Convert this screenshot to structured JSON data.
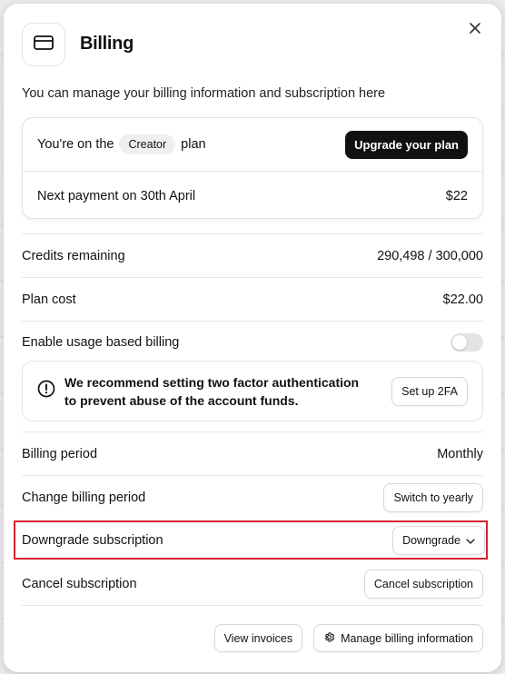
{
  "dialog": {
    "title": "Billing",
    "subtitle": "You can manage your billing information and subscription here",
    "header_icon": "credit-card-icon",
    "close_icon": "close-icon"
  },
  "plan": {
    "prefix": "You're on the",
    "name": "Creator",
    "suffix": "plan",
    "upgrade_label": "Upgrade your plan",
    "next_payment_label": "Next payment on 30th April",
    "next_payment_amount": "$22"
  },
  "credits": {
    "label": "Credits remaining",
    "value": "290,498 / 300,000"
  },
  "plan_cost": {
    "label": "Plan cost",
    "value": "$22.00"
  },
  "usage_billing": {
    "label": "Enable usage based billing",
    "enabled": false
  },
  "alert": {
    "icon": "alert-circle-icon",
    "line1": "We recommend setting two factor authentication",
    "line2": "to prevent abuse of the account funds.",
    "button_label": "Set up 2FA"
  },
  "billing_period": {
    "label": "Billing period",
    "value": "Monthly"
  },
  "change_period": {
    "label": "Change billing period",
    "button_label": "Switch to yearly"
  },
  "downgrade": {
    "label": "Downgrade subscription",
    "button_label": "Downgrade"
  },
  "cancel": {
    "label": "Cancel subscription",
    "button_label": "Cancel subscription"
  },
  "footer": {
    "view_invoices_label": "View invoices",
    "manage_billing_label": "Manage billing information",
    "manage_icon": "gear-icon"
  },
  "colors": {
    "highlight": "#d9202f",
    "primary_button": "#111111"
  }
}
